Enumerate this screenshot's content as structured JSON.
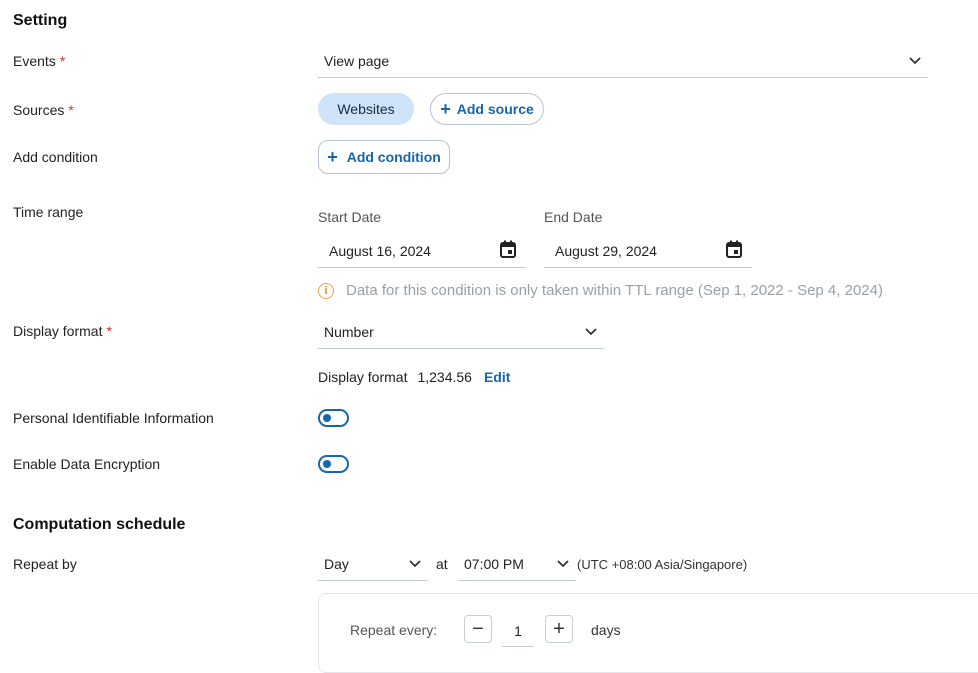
{
  "setting": {
    "title": "Setting",
    "events": {
      "label": "Events",
      "required_mark": "*",
      "value": "View page"
    },
    "sources": {
      "label": "Sources",
      "required_mark": "*",
      "chip": "Websites",
      "add_button": "Add source"
    },
    "add_condition": {
      "label": "Add condition",
      "button": "Add condition"
    },
    "time_range": {
      "label": "Time range",
      "start_label": "Start Date",
      "start_value": "August 16, 2024",
      "end_label": "End Date",
      "end_value": "August 29, 2024",
      "info_text": "Data for this condition is only taken within TTL range (Sep 1, 2022 - Sep 4, 2024)"
    },
    "display_format": {
      "label": "Display format",
      "required_mark": "*",
      "value": "Number",
      "preview_label": "Display format",
      "preview_value": "1,234.56",
      "edit_link": "Edit"
    },
    "pii": {
      "label": "Personal Identifiable Information",
      "enabled": false
    },
    "encryption": {
      "label": "Enable Data Encryption",
      "enabled": false
    }
  },
  "schedule": {
    "title": "Computation schedule",
    "repeat_by": {
      "label": "Repeat by",
      "value": "Day"
    },
    "at_label": "at",
    "time": {
      "value": "07:00 PM"
    },
    "timezone": "(UTC +08:00 Asia/Singapore)",
    "repeat_every": {
      "label": "Repeat every:",
      "value": "1",
      "unit": "days",
      "minus": "−",
      "plus": "+"
    }
  },
  "icons": {
    "chevron": "chevron-down-icon",
    "calendar": "calendar-icon",
    "info": "info-icon",
    "plus": "plus-icon"
  },
  "colors": {
    "accent": "#1765ad",
    "chip_bg": "#cfe4f9",
    "required": "#d32f2f",
    "info": "#f0a04b"
  }
}
